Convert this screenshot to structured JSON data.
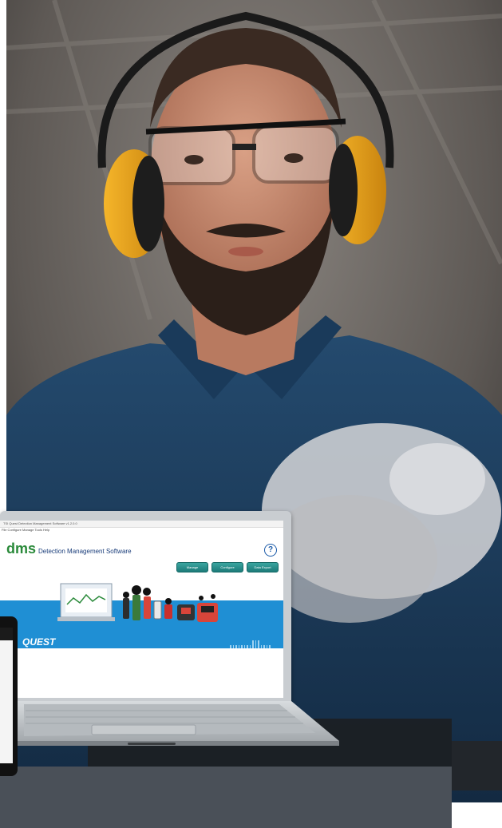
{
  "photo": {
    "subject": "man-with-earmuffs",
    "colors": {
      "shirt": "#1d3e5e",
      "earmuff": "#f0a81f",
      "background": "#6c6763"
    }
  },
  "software": {
    "window_title": "TSI Quest Detection Management Software v1.2.0.0",
    "menu": "File  Configure  Manage  Tools  Help",
    "logo": "dms",
    "product_name": "Detection Management Software",
    "help_symbol": "?",
    "buttons": [
      "Manage",
      "Configure",
      "Data Export"
    ],
    "brand": "QUEST",
    "accent": "#1f8fd4"
  }
}
